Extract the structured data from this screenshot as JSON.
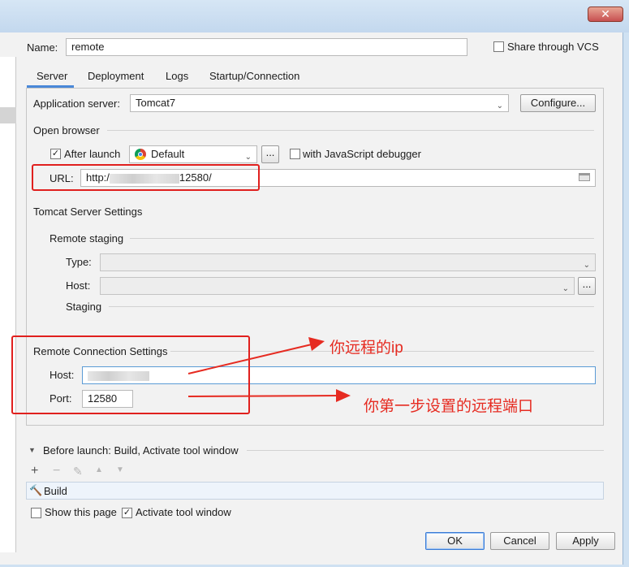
{
  "window": {
    "close_glyph": "✕"
  },
  "header": {
    "name_label": "Name:",
    "name_value": "remote",
    "share_label": "Share through VCS"
  },
  "tabs": [
    {
      "label": "Server",
      "active": true
    },
    {
      "label": "Deployment"
    },
    {
      "label": "Logs"
    },
    {
      "label": "Startup/Connection"
    }
  ],
  "server": {
    "app_server_label": "Application server:",
    "app_server_value": "Tomcat7",
    "configure_label": "Configure...",
    "open_browser_label": "Open browser",
    "after_launch_label": "After launch",
    "browser_value": "Default",
    "more_button": "...",
    "js_debugger_label": "with JavaScript debugger",
    "url_label": "URL:",
    "url_prefix": "http:/",
    "url_suffix": "12580/",
    "tomcat_settings_label": "Tomcat Server Settings",
    "remote_staging_label": "Remote staging",
    "type_label": "Type:",
    "host_label": "Host:",
    "staging_label": "Staging",
    "remote_connection_label": "Remote Connection Settings",
    "rc_host_label": "Host:",
    "rc_port_label": "Port:",
    "rc_port_value": "12580"
  },
  "before_launch": {
    "label": "Before launch: Build, Activate tool window",
    "items": [
      "Build"
    ],
    "show_page_label": "Show this page",
    "activate_label": "Activate tool window"
  },
  "footer": {
    "ok": "OK",
    "cancel": "Cancel",
    "apply": "Apply"
  },
  "annotations": {
    "host_note": "你远程的ip",
    "port_note": "你第一步设置的远程端口"
  },
  "colors": {
    "annotation_red": "#e62b21",
    "accent_blue": "#4a88d8"
  }
}
